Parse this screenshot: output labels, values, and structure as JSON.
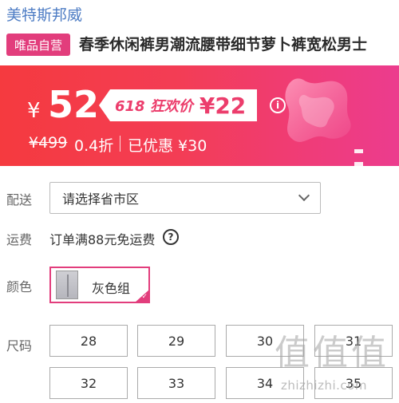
{
  "store": {
    "name": "美特斯邦威"
  },
  "product": {
    "badge": "唯品自营",
    "title": "春季休闲裤男潮流腰带细节萝卜裤宽松男士"
  },
  "price": {
    "currency": "¥",
    "current": "52",
    "promo_label": "618 狂欢价",
    "promo_price": "¥22",
    "original": "¥499",
    "discount": "0.4折",
    "saved": "已优惠 ¥30",
    "info_icon": "i"
  },
  "delivery": {
    "label": "配送",
    "placeholder": "请选择省市区"
  },
  "shipping": {
    "label": "运费",
    "text": "订单满88元免运费",
    "help_icon": "?"
  },
  "color": {
    "label": "颜色",
    "selected": "灰色组",
    "check_mark": "✓"
  },
  "size": {
    "label": "尺码",
    "options": [
      "28",
      "29",
      "30",
      "31",
      "32",
      "33",
      "34",
      "35"
    ]
  },
  "watermark": {
    "glyphs": "值",
    "text": "zhizhizhi.com"
  },
  "colors": {
    "accent": "#e23d7c",
    "banner_start": "#f53a3f",
    "banner_end": "#ec3c8e",
    "link": "#4d7cc4"
  }
}
